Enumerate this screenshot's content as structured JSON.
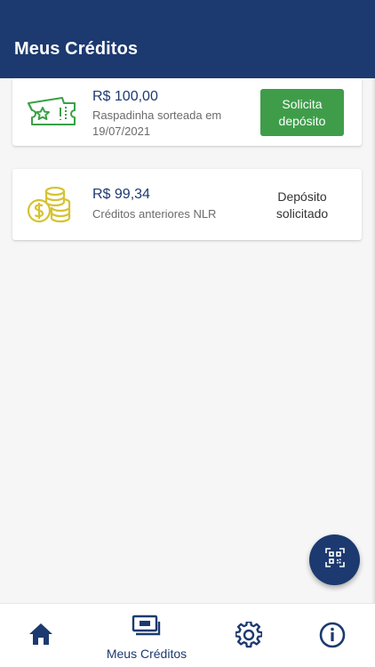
{
  "app": {
    "title": "Meus Créditos"
  },
  "credits": [
    {
      "icon": "ticket-star-icon",
      "amount": "R$ 100,00",
      "description": "Raspadinha sorteada em 19/07/2021",
      "action_label": "Solicita depósito"
    },
    {
      "icon": "coins-dollar-icon",
      "amount": "R$ 99,34",
      "description": "Créditos anteriores NLR",
      "status": "Depósito solicitado"
    }
  ],
  "fab": {
    "icon": "qr-code-icon"
  },
  "bottom_nav": {
    "items": [
      {
        "icon": "home-icon"
      },
      {
        "icon": "wallet-cards-icon",
        "label": "Meus Créditos"
      },
      {
        "icon": "gear-icon"
      },
      {
        "icon": "info-icon"
      }
    ]
  },
  "colors": {
    "primary": "#1c3a70",
    "accent_green": "#3f9d4a",
    "ticket_icon": "#3aa047",
    "coins_icon": "#d6c331"
  }
}
